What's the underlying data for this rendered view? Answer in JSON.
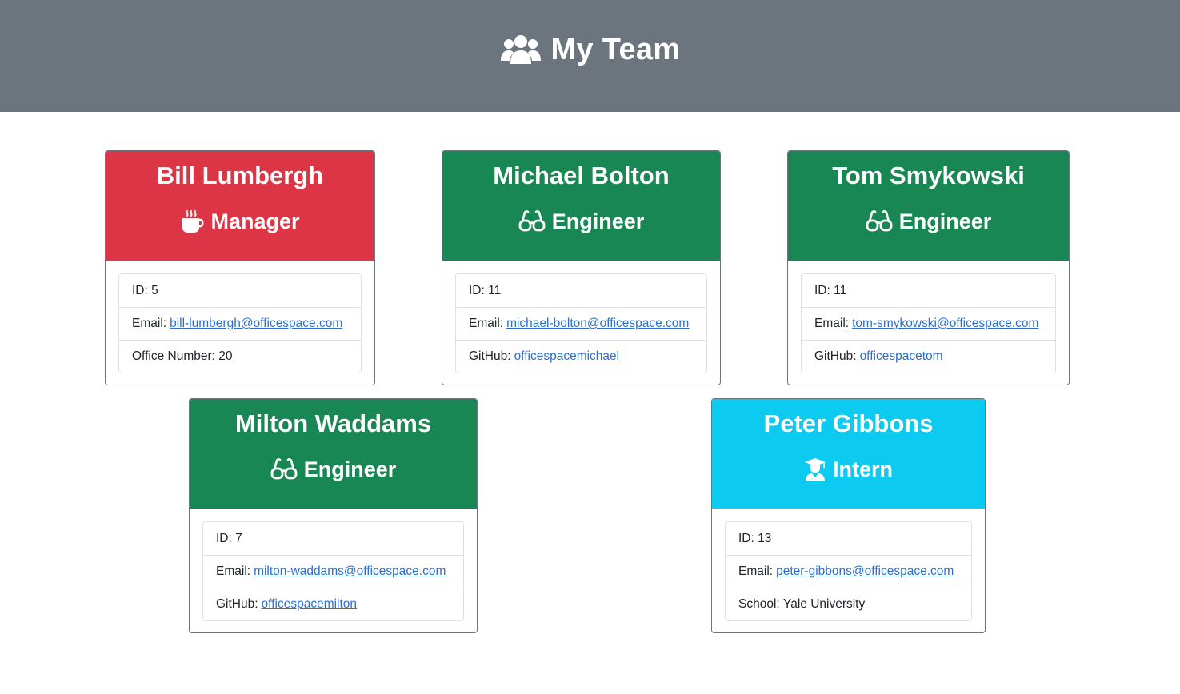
{
  "header": {
    "title": "My Team",
    "icon": "users-icon"
  },
  "colors": {
    "header_bg": "#6c757d",
    "manager": "#dc3545",
    "engineer": "#198754",
    "intern": "#0dcaf0",
    "link": "#2b6fd0"
  },
  "labels": {
    "id": "ID:",
    "email": "Email:",
    "office": "Office Number:",
    "github": "GitHub:",
    "school": "School:"
  },
  "cards": [
    {
      "name": "Bill Lumbergh",
      "role": "Manager",
      "role_icon": "mug-hot-icon",
      "id": "5",
      "email": "bill-lumbergh@officespace.com",
      "office_number": "20"
    },
    {
      "name": "Michael Bolton",
      "role": "Engineer",
      "role_icon": "glasses-icon",
      "id": "11",
      "email": "michael-bolton@officespace.com",
      "github": "officespacemichael"
    },
    {
      "name": "Tom Smykowski",
      "role": "Engineer",
      "role_icon": "glasses-icon",
      "id": "11",
      "email": "tom-smykowski@officespace.com",
      "github": "officespacetom"
    },
    {
      "name": "Milton Waddams",
      "role": "Engineer",
      "role_icon": "glasses-icon",
      "id": "7",
      "email": "milton-waddams@officespace.com",
      "github": "officespacemilton"
    },
    {
      "name": "Peter Gibbons",
      "role": "Intern",
      "role_icon": "user-graduate-icon",
      "id": "13",
      "email": "peter-gibbons@officespace.com",
      "school": "Yale University"
    }
  ]
}
